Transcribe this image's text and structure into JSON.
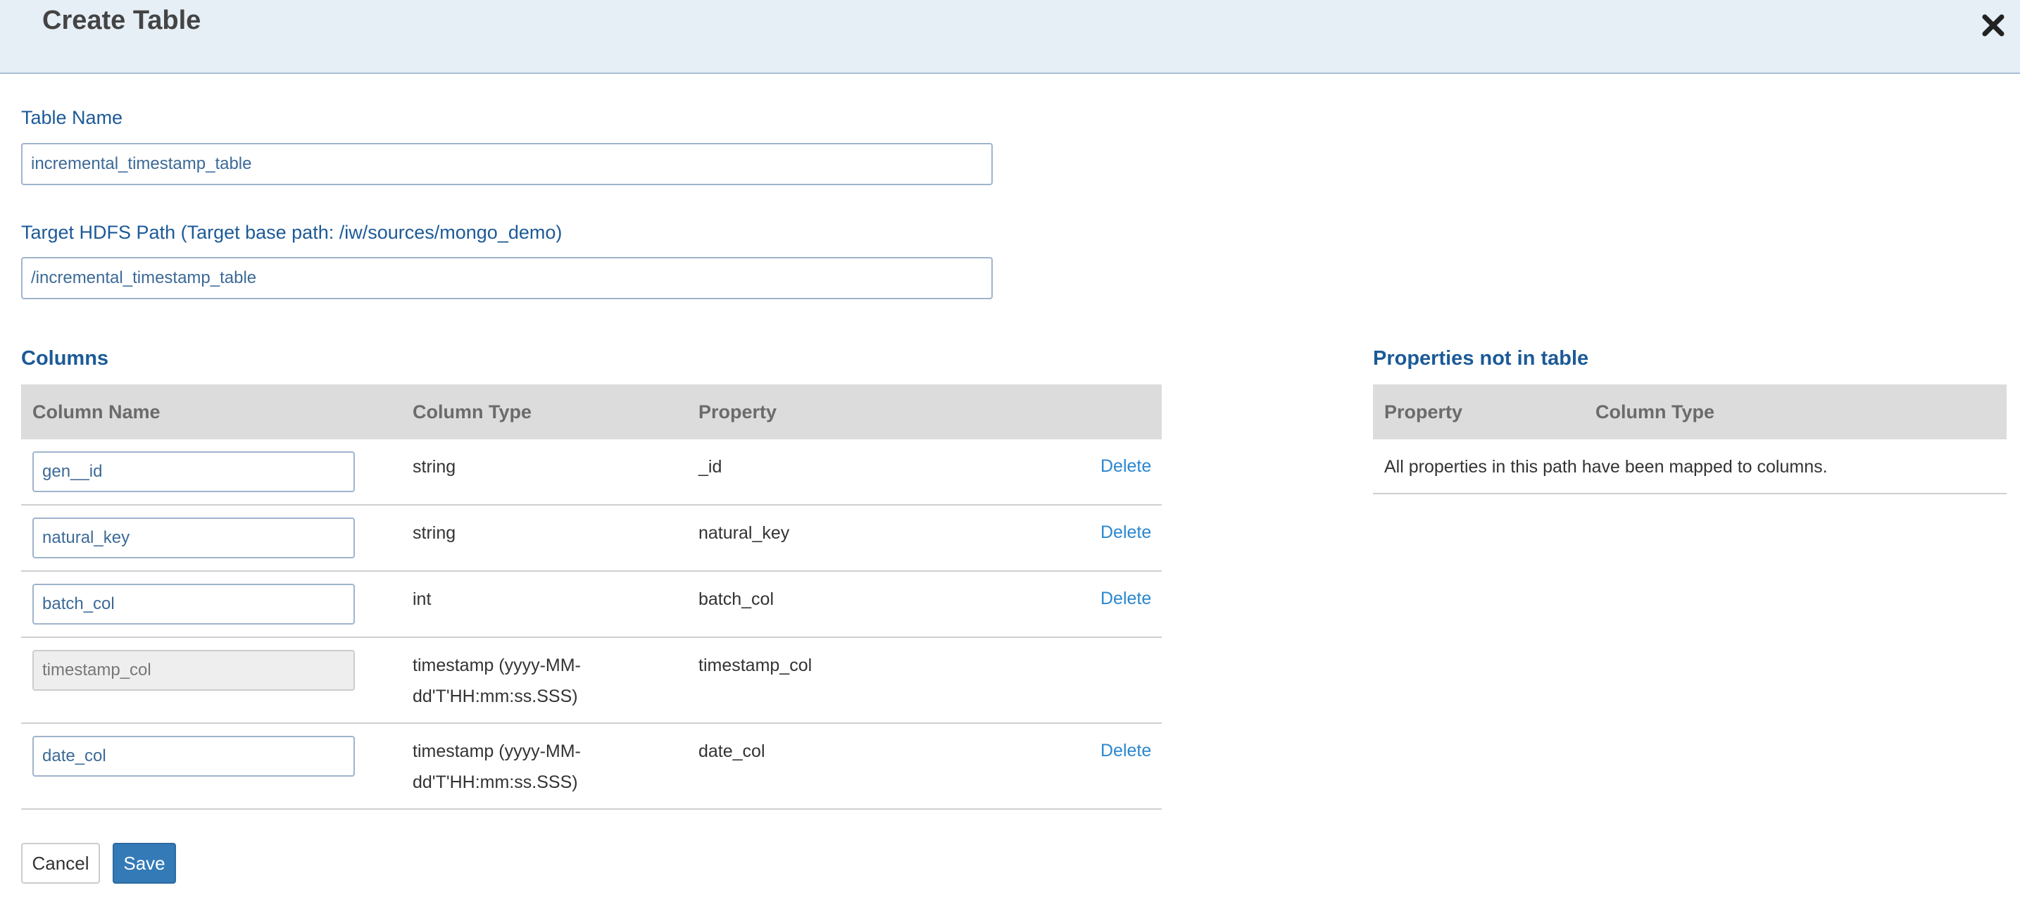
{
  "header": {
    "title": "Create Table",
    "close_icon": "close-icon"
  },
  "form": {
    "table_name_label": "Table Name",
    "table_name_value": "incremental_timestamp_table",
    "hdfs_label": "Target HDFS Path (Target base path: /iw/sources/mongo_demo)",
    "hdfs_value": "/incremental_timestamp_table"
  },
  "columns": {
    "title": "Columns",
    "headers": {
      "name": "Column Name",
      "type": "Column Type",
      "property": "Property"
    },
    "rows": [
      {
        "name": "gen__id",
        "type": "string",
        "property": "_id",
        "action": "Delete",
        "editable": true
      },
      {
        "name": "natural_key",
        "type": "string",
        "property": "natural_key",
        "action": "Delete",
        "editable": true
      },
      {
        "name": "batch_col",
        "type": "int",
        "property": "batch_col",
        "action": "Delete",
        "editable": true
      },
      {
        "name": "timestamp_col",
        "type_line1": "timestamp (yyyy-MM-",
        "type_line2": "dd'T'HH:mm:ss.SSS)",
        "property": "timestamp_col",
        "action": "",
        "editable": false
      },
      {
        "name": "date_col",
        "type_line1": "timestamp (yyyy-MM-",
        "type_line2": "dd'T'HH:mm:ss.SSS)",
        "property": "date_col",
        "action": "Delete",
        "editable": true
      }
    ]
  },
  "properties_not_in_table": {
    "title": "Properties not in table",
    "headers": {
      "property": "Property",
      "type": "Column Type"
    },
    "empty_message": "All properties in this path have been mapped to columns."
  },
  "footer": {
    "cancel_label": "Cancel",
    "save_label": "Save"
  },
  "colors": {
    "header_bg": "#e6eef6",
    "label_blue": "#1c5a97",
    "link_blue": "#2a87d0",
    "save_blue": "#337ab7",
    "table_header_bg": "#dcdcdc"
  }
}
